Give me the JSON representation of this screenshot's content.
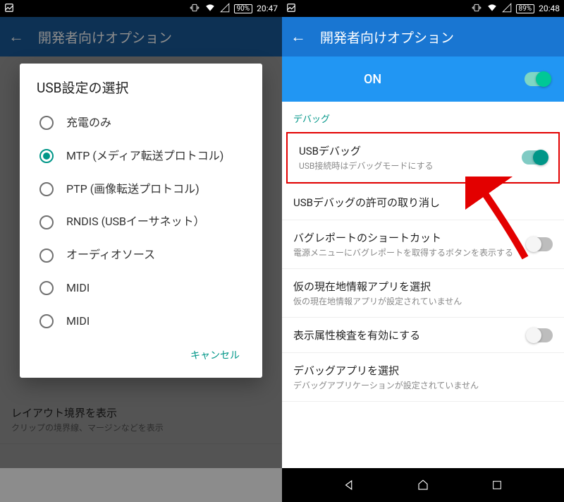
{
  "left": {
    "status": {
      "battery": "90%",
      "time": "20:47"
    },
    "header": {
      "title": "開発者向けオプション"
    },
    "dialog": {
      "title": "USB設定の選択",
      "options": [
        {
          "label": "充電のみ",
          "selected": false
        },
        {
          "label": "MTP (メディア転送プロトコル)",
          "selected": true
        },
        {
          "label": "PTP (画像転送プロトコル)",
          "selected": false
        },
        {
          "label": "RNDIS (USBイーサネット）",
          "selected": false
        },
        {
          "label": "オーディオソース",
          "selected": false
        },
        {
          "label": "MIDI",
          "selected": false
        },
        {
          "label": "MIDI",
          "selected": false
        }
      ],
      "cancel": "キャンセル"
    },
    "bg_bottom": {
      "title": "レイアウト境界を表示",
      "sub": "クリップの境界線、マージンなどを表示"
    }
  },
  "right": {
    "status": {
      "battery": "89%",
      "time": "20:48"
    },
    "header": {
      "title": "開発者向けオプション"
    },
    "on_label": "ON",
    "section": "デバッグ",
    "items": [
      {
        "title": "USBデバッグ",
        "sub": "USB接続時はデバッグモードにする",
        "toggle": "on",
        "highlighted": true
      },
      {
        "title": "USBデバッグの許可の取り消し",
        "sub": "",
        "toggle": null
      },
      {
        "title": "バグレポートのショートカット",
        "sub": "電源メニューにバグレポートを取得するボタンを表示する",
        "toggle": "off"
      },
      {
        "title": "仮の現在地情報アプリを選択",
        "sub": "仮の現在地情報アプリが設定されていません",
        "toggle": null
      },
      {
        "title": "表示属性検査を有効にする",
        "sub": "",
        "toggle": "off"
      },
      {
        "title": "デバッグアプリを選択",
        "sub": "デバッグアプリケーションが設定されていません",
        "toggle": null
      }
    ]
  }
}
